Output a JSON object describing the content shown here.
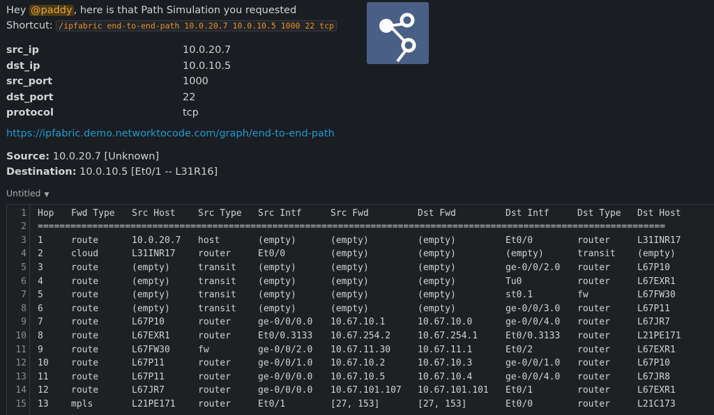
{
  "message": {
    "greeting_prefix": "Hey ",
    "mention": "@paddy",
    "greeting_suffix": ", here is that Path Simulation you requested",
    "shortcut_label": "Shortcut:",
    "shortcut_command": "/ipfabric end-to-end-path 10.0.20.7 10.0.10.5 1000 22 tcp"
  },
  "logo": {
    "icon": "ipfabric-graph-icon",
    "bg_color": "#4a5f86"
  },
  "params": [
    {
      "key": "src_ip",
      "value": "10.0.20.7"
    },
    {
      "key": "dst_ip",
      "value": "10.0.10.5"
    },
    {
      "key": "src_port",
      "value": "1000"
    },
    {
      "key": "dst_port",
      "value": "22"
    },
    {
      "key": "protocol",
      "value": "tcp"
    }
  ],
  "graph_link": "https://ipfabric.demo.networktocode.com/graph/end-to-end-path",
  "source_label": "Source:",
  "source_value": " 10.0.20.7 [Unknown]",
  "destination_label": "Destination:",
  "destination_value": " 10.0.10.5 [Et0/1 -- L31R16]",
  "snippet": {
    "title": "Untitled",
    "line_numbers": [
      "1",
      "2",
      "3",
      "4",
      "5",
      "6",
      "7",
      "8",
      "9",
      "10",
      "11",
      "12",
      "13",
      "14",
      "15"
    ],
    "separator": "===================================================================================================================",
    "headers": [
      "Hop",
      "Fwd Type",
      "Src Host",
      "Src Type",
      "Src Intf",
      "Src Fwd",
      "Dst Fwd",
      "Dst Intf",
      "Dst Type",
      "Dst Host"
    ],
    "rows": [
      [
        "1",
        "route",
        "10.0.20.7",
        "host",
        "(empty)",
        "(empty)",
        "(empty)",
        "Et0/0",
        "router",
        "L31INR17"
      ],
      [
        "2",
        "cloud",
        "L31INR17",
        "router",
        "Et0/0",
        "(empty)",
        "(empty)",
        "(empty)",
        "transit",
        "(empty)"
      ],
      [
        "3",
        "route",
        "(empty)",
        "transit",
        "(empty)",
        "(empty)",
        "(empty)",
        "ge-0/0/2.0",
        "router",
        "L67P10"
      ],
      [
        "4",
        "route",
        "(empty)",
        "transit",
        "(empty)",
        "(empty)",
        "(empty)",
        "Tu0",
        "router",
        "L67EXR1"
      ],
      [
        "5",
        "route",
        "(empty)",
        "transit",
        "(empty)",
        "(empty)",
        "(empty)",
        "st0.1",
        "fw",
        "L67FW30"
      ],
      [
        "6",
        "route",
        "(empty)",
        "transit",
        "(empty)",
        "(empty)",
        "(empty)",
        "ge-0/0/3.0",
        "router",
        "L67P11"
      ],
      [
        "7",
        "route",
        "L67P10",
        "router",
        "ge-0/0/0.0",
        "10.67.10.1",
        "10.67.10.0",
        "ge-0/0/4.0",
        "router",
        "L67JR7"
      ],
      [
        "8",
        "route",
        "L67EXR1",
        "router",
        "Et0/0.3133",
        "10.67.254.2",
        "10.67.254.1",
        "Et0/0.3133",
        "router",
        "L21PE171"
      ],
      [
        "9",
        "route",
        "L67FW30",
        "fw",
        "ge-0/0/2.0",
        "10.67.11.30",
        "10.67.11.1",
        "Et0/2",
        "router",
        "L67EXR1"
      ],
      [
        "10",
        "route",
        "L67P11",
        "router",
        "ge-0/0/1.0",
        "10.67.10.2",
        "10.67.10.3",
        "ge-0/0/1.0",
        "router",
        "L67P10"
      ],
      [
        "11",
        "route",
        "L67P11",
        "router",
        "ge-0/0/0.0",
        "10.67.10.5",
        "10.67.10.4",
        "ge-0/0/4.0",
        "router",
        "L67JR8"
      ],
      [
        "12",
        "route",
        "L67JR7",
        "router",
        "ge-0/0/0.0",
        "10.67.101.107",
        "10.67.101.101",
        "Et0/1",
        "router",
        "L67EXR1"
      ],
      [
        "13",
        "mpls",
        "L21PE171",
        "router",
        "Et0/1",
        "[27, 153]",
        "[27, 153]",
        "Et0/0",
        "router",
        "L21C173"
      ]
    ]
  }
}
